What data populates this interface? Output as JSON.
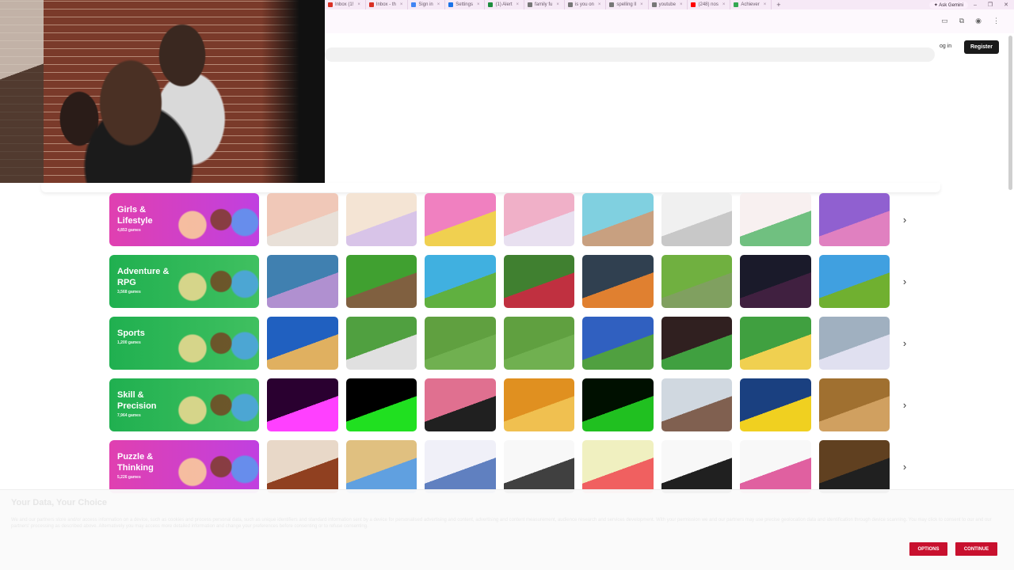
{
  "browser": {
    "tabs": [
      {
        "label": "Inbox (1!",
        "color": "#d93025"
      },
      {
        "label": "Inbox - th",
        "color": "#d93025"
      },
      {
        "label": "Sign in",
        "color": "#4285f4"
      },
      {
        "label": "Settings",
        "color": "#1a73e8"
      },
      {
        "label": "(1) Alert",
        "color": "#1e8e3e"
      },
      {
        "label": "family fu",
        "color": "#777777"
      },
      {
        "label": "is you on",
        "color": "#777777"
      },
      {
        "label": "spelling ll",
        "color": "#777777"
      },
      {
        "label": "youtube",
        "color": "#777777"
      },
      {
        "label": "(248) nos",
        "color": "#ff0000"
      },
      {
        "label": "Achiever",
        "color": "#34a853"
      }
    ],
    "new_tab": "+",
    "ask_gemini": "✦ Ask Gemini",
    "win_min": "–",
    "win_max": "❐",
    "win_close": "✕"
  },
  "header": {
    "login": "og in",
    "register": "Register"
  },
  "categories": [
    {
      "title": "Girls & Lifestyle",
      "count": "4,853 games",
      "grad": [
        "#e040b0",
        "#c040e0"
      ],
      "thumbs": [
        [
          "#f0c8b8",
          "#e8e0d8"
        ],
        [
          "#f4e4d4",
          "#d8c4e8"
        ],
        [
          "#f080c0",
          "#f0d050"
        ],
        [
          "#f0b0c8",
          "#e8e0f0"
        ],
        [
          "#80d0e0",
          "#c8a080"
        ],
        [
          "#f0f0f0",
          "#c8c8c8"
        ],
        [
          "#f8f0f0",
          "#70c080"
        ],
        [
          "#9060d0",
          "#e080c0"
        ]
      ]
    },
    {
      "title": "Adventure & RPG",
      "count": "3,568 games",
      "grad": [
        "#20b050",
        "#40c060"
      ],
      "thumbs": [
        [
          "#4080b0",
          "#b090d0"
        ],
        [
          "#40a030",
          "#806040"
        ],
        [
          "#40b0e0",
          "#60b040"
        ],
        [
          "#408030",
          "#c03040"
        ],
        [
          "#304050",
          "#e08030"
        ],
        [
          "#70b040",
          "#80a060"
        ],
        [
          "#1a1a2a",
          "#402040"
        ],
        [
          "#40a0e0",
          "#70b030"
        ]
      ]
    },
    {
      "title": "Sports",
      "count": "1,200 games",
      "grad": [
        "#20b050",
        "#40c060"
      ],
      "thumbs": [
        [
          "#2060c0",
          "#e0b060"
        ],
        [
          "#50a040",
          "#e0e0e0"
        ],
        [
          "#60a040",
          "#70b050"
        ],
        [
          "#60a040",
          "#70b050"
        ],
        [
          "#3060c0",
          "#50a040"
        ],
        [
          "#302020",
          "#40a040"
        ],
        [
          "#40a040",
          "#f0d050"
        ],
        [
          "#a0b0c0",
          "#e0e0f0"
        ]
      ]
    },
    {
      "title": "Skill & Precision",
      "count": "7,964 games",
      "grad": [
        "#20b050",
        "#40c060"
      ],
      "thumbs": [
        [
          "#2a0030",
          "#ff40ff"
        ],
        [
          "#000000",
          "#20e020"
        ],
        [
          "#e07090",
          "#202020"
        ],
        [
          "#e09020",
          "#f0c050"
        ],
        [
          "#001000",
          "#20c020"
        ],
        [
          "#d0d8e0",
          "#806050"
        ],
        [
          "#1a4080",
          "#f0d020"
        ],
        [
          "#a07030",
          "#d0a060"
        ]
      ]
    },
    {
      "title": "Puzzle & Thinking",
      "count": "5,226 games",
      "grad": [
        "#e040b0",
        "#c040e0"
      ],
      "thumbs": [
        [
          "#e8d8c8",
          "#904020"
        ],
        [
          "#e0c080",
          "#60a0e0"
        ],
        [
          "#f0f0f8",
          "#6080c0"
        ],
        [
          "#f8f8f8",
          "#404040"
        ],
        [
          "#f0f0c0",
          "#f06060"
        ],
        [
          "#f8f8f8",
          "#202020"
        ],
        [
          "#f8f8f8",
          "#e060a0"
        ],
        [
          "#604020",
          "#202020"
        ]
      ]
    }
  ],
  "arrow": "›",
  "cookie": {
    "title": "Your Data, Your Choice",
    "text": "We and our partners store and/or access information on a device, such as cookies and process personal data, such as unique identifiers and standard information sent by a device for personalised advertising and content, advertising and content measurement, audience research and services development. With your permission we and our partners may use precise geolocation data and identification through device scanning. You may click to consent to our and our partners' processing as described above. Alternatively you may access more detailed information and change your preferences before consenting or to refuse consenting.",
    "options": "OPTIONS",
    "continue": "CONTINUE"
  }
}
